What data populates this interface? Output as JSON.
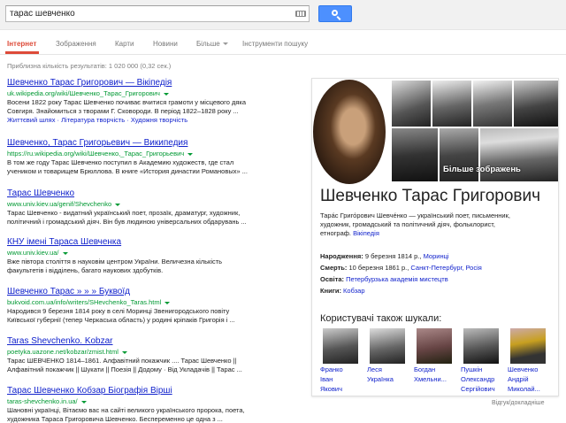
{
  "search": {
    "query": "тарас шевченко"
  },
  "tabs": [
    {
      "label": "Інтернет",
      "active": true
    },
    {
      "label": "Зображення"
    },
    {
      "label": "Карти"
    },
    {
      "label": "Новини"
    },
    {
      "label": "Більше"
    },
    {
      "label": "Інструменти пошуку"
    }
  ],
  "result_stats": "Приблизна кількість результатів: 1 020 000 (0,32 сек.)",
  "results": [
    {
      "title": "Шевченко Тарас Григорович — Вікіпедія",
      "url": "uk.wikipedia.org/wiki/Шевченко_Тарас_Григорович",
      "snippet": [
        "Восени 1822 року Тарас Шевченко почиває вчитися грамоти у місцевого дяка",
        "Совгиря. Знайомиться з творами Г. Сковороди. В період 1822–1828 року ..."
      ],
      "sub": "Життєвий шлях · Література творчість · Художня творчість"
    },
    {
      "title": "Шевченко, Тарас Григорьевич — Википедия",
      "url": "https://ru.wikipedia.org/wiki/Шевченко,_Тарас_Григорьевич",
      "snippet": [
        "В том же году Тарас Шевченко поступил в Академию художеств, где стал",
        "учеником и товарищем Брюллова. В книге «История династии Романовых» ..."
      ]
    },
    {
      "title": "Тарас Шевченко",
      "url": "www.univ.kiev.ua/genif/Shevchenko",
      "snippet": [
        "Тарас Шевченко - видатний український поет, прозаїк, драматург, художник,",
        "політичний і громадський діяч. Він був людиною універсальних обдарувань ..."
      ]
    },
    {
      "title": "КНУ імені Тараса Шевченка",
      "url": "www.univ.kiev.ua/",
      "snippet": [
        "Вже півтора століття в науковім центром України. Величезна кількість",
        "факультетів і відділень, багато наукових здобутків."
      ]
    },
    {
      "title": "Шевченко Тарас » » » Буквоїд",
      "url": "bukvoid.com.ua/info/writers/SHevchenko_Taras.html",
      "snippet": [
        "Народився 9 березня 1814 року в селі Моринці Звенигородського повіту",
        "Київської губернії (тепер Черкаська область) у родині кріпаків Григорія і ..."
      ]
    },
    {
      "title": "Taras Shevchenko. Kobzar",
      "url": "poetyka.uazone.net/kobzar/zmist.html",
      "snippet": [
        "Тарас ШЕВЧЕНКО 1814–1861. Алфавітний покажчик .... Тарас Шевченко ||",
        "Алфавітний покажчик || Шукати || Поезія || Додому · Від Укладачів || Тарас ..."
      ]
    },
    {
      "title": "Тарас Шевченко Кобзар Біографія Вірші",
      "url": "taras-shevchenko.in.ua/",
      "snippet": [
        "Шановні українці, Вітаємо вас на сайті великого українського пророка, поета,",
        "художника Тараса Григоровича Шевченко. Беспеременно це одна з ..."
      ]
    }
  ],
  "knowledge": {
    "more_images": "Більше зображень",
    "title": "Шевченко Тарас Григорович",
    "desc": [
      "Тара́с Григо́рович Шевче́нко — український поет, письменник,",
      "художник, громадський та політичний діяч, фольклорист,",
      "етнограф."
    ],
    "desc_link": "Вікіпедія",
    "facts": [
      {
        "label": "Народження:",
        "text": "9 березня 1814 р., ",
        "link": "Моринці"
      },
      {
        "label": "Смерть:",
        "text": "10 березня 1861 р., ",
        "link": "Санкт-Петербург, Росія"
      },
      {
        "label": "Освіта:",
        "text": "",
        "link": "Петербурзька академія мистецтв"
      },
      {
        "label": "Книги:",
        "text": "",
        "link": "Кобзар"
      }
    ],
    "also_title": "Користувачі також шукали:",
    "people": [
      {
        "name1": "Франко",
        "name2": "Іван",
        "name3": "Якович"
      },
      {
        "name1": "Леся",
        "name2": "Українка",
        "name3": ""
      },
      {
        "name1": "Богдан",
        "name2": "Хмельни...",
        "name3": ""
      },
      {
        "name1": "Пушкін",
        "name2": "Олександр",
        "name3": "Сергійович"
      },
      {
        "name1": "Шевченко",
        "name2": "Андрій",
        "name3": "Миколай..."
      }
    ]
  },
  "feedback": "Відгук/докладніше"
}
